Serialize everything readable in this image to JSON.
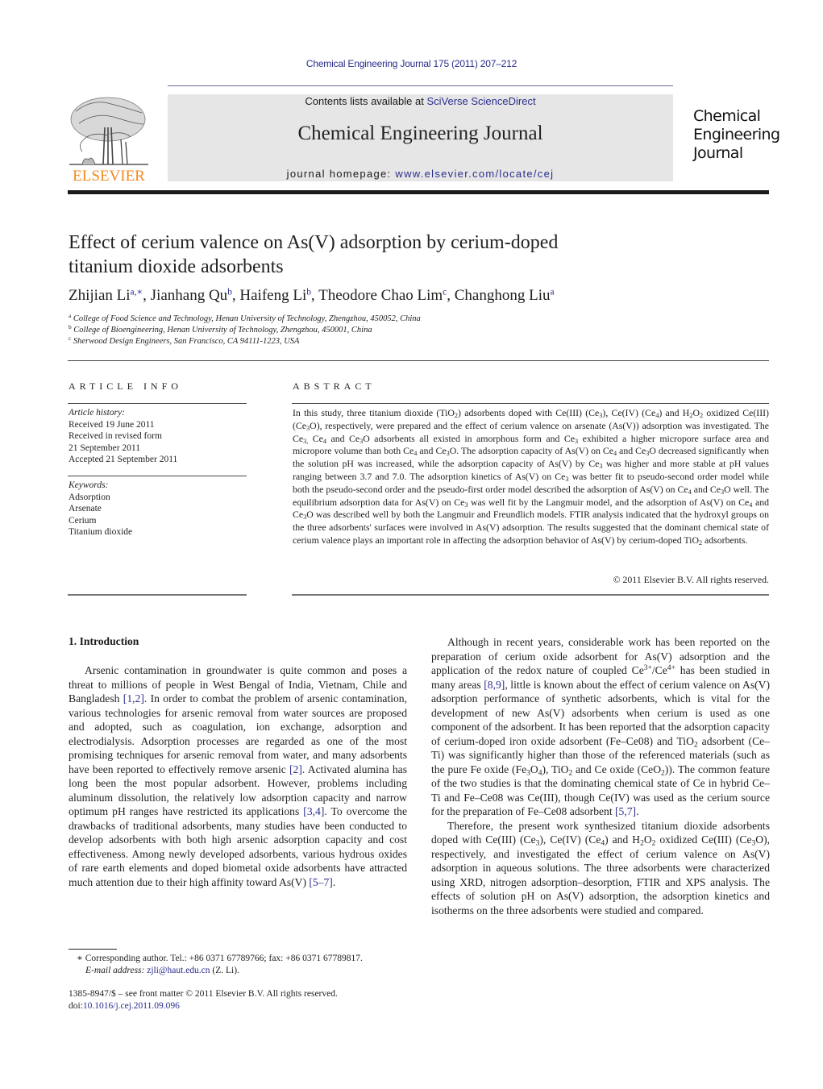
{
  "header": {
    "running_head": "Chemical Engineering Journal 175 (2011) 207–212",
    "publisher_logo_text": "ELSEVIER",
    "contents_prefix": "Contents lists available at ",
    "contents_link": "SciVerse ScienceDirect",
    "journal_name": "Chemical Engineering Journal",
    "homepage_prefix": "journal homepage: ",
    "homepage_link": "www.elsevier.com/locate/cej",
    "cover_title_lines": [
      "Chemical",
      "Engineering",
      "Journal"
    ]
  },
  "article": {
    "title_line1": "Effect of cerium valence on As(V) adsorption by cerium-doped",
    "title_line2": "titanium dioxide adsorbents",
    "authors": [
      {
        "name": "Zhijian Li",
        "affil": "a,∗"
      },
      {
        "name": "Jianhang Qu",
        "affil": "b"
      },
      {
        "name": "Haifeng Li",
        "affil": "b"
      },
      {
        "name": "Theodore Chao Lim",
        "affil": "c"
      },
      {
        "name": "Changhong Liu",
        "affil": "a"
      }
    ],
    "affiliations": [
      {
        "mark": "a",
        "text": "College of Food Science and Technology, Henan University of Technology, Zhengzhou, 450052, China"
      },
      {
        "mark": "b",
        "text": "College of Bioengineering, Henan University of Technology, Zhengzhou, 450001, China"
      },
      {
        "mark": "c",
        "text": "Sherwood Design Engineers, San Francisco, CA 94111-1223, USA"
      }
    ]
  },
  "article_info": {
    "label": "ARTICLE INFO",
    "history_heading": "Article history:",
    "history": [
      "Received 19 June 2011",
      "Received in revised form",
      "21 September 2011",
      "Accepted 21 September 2011"
    ],
    "keywords_heading": "Keywords:",
    "keywords": [
      "Adsorption",
      "Arsenate",
      "Cerium",
      "Titanium dioxide"
    ]
  },
  "abstract": {
    "label": "ABSTRACT",
    "html": "In this study, three titanium dioxide (TiO<sub>2</sub>) adsorbents doped with Ce(III) (Ce<sub>3</sub>), Ce(IV) (Ce<sub>4</sub>) and H<sub>2</sub>O<sub>2</sub> oxidized Ce(III) (Ce<sub>3</sub>O), respectively, were prepared and the effect of cerium valence on arsenate (As(V)) adsorption was investigated. The Ce<sub>3,</sub> Ce<sub>4</sub> and Ce<sub>3</sub>O adsorbents all existed in amorphous form and Ce<sub>3</sub> exhibited a higher micropore surface area and micropore volume than both Ce<sub>4</sub> and Ce<sub>3</sub>O. The adsorption capacity of As(V) on Ce<sub>4</sub> and Ce<sub>3</sub>O decreased significantly when the solution pH was increased, while the adsorption capacity of As(V) by Ce<sub>3</sub> was higher and more stable at pH values ranging between 3.7 and 7.0. The adsorption kinetics of As(V) on Ce<sub>3</sub> was better fit to pseudo-second order model while both the pseudo-second order and the pseudo-first order model described the adsorption of As(V) on Ce<sub>4</sub> and Ce<sub>3</sub>O well. The equilibrium adsorption data for As(V) on Ce<sub>3</sub> was well fit by the Langmuir model, and the adsorption of As(V) on Ce<sub>4</sub> and Ce<sub>3</sub>O was described well by both the Langmuir and Freundlich models. FTIR analysis indicated that the hydroxyl groups on the three adsorbents' surfaces were involved in As(V) adsorption. The results suggested that the dominant chemical state of cerium valence plays an important role in affecting the adsorption behavior of As(V) by cerium-doped TiO<sub>2</sub> adsorbents.",
    "copyright": "© 2011 Elsevier B.V. All rights reserved."
  },
  "body": {
    "section_heading": "1.  Introduction",
    "left_paragraphs": [
      "Arsenic contamination in groundwater is quite common and poses a threat to millions of people in West Bengal of India, Vietnam, Chile and Bangladesh <span class=\"link\">[1,2]</span>. In order to combat the problem of arsenic contamination, various technologies for arsenic removal from water sources are proposed and adopted, such as coagulation, ion exchange, adsorption and electrodialysis. Adsorption processes are regarded as one of the most promising techniques for arsenic removal from water, and many adsorbents have been reported to effectively remove arsenic <span class=\"link\">[2]</span>. Activated alumina has long been the most popular adsorbent. However, problems including aluminum dissolution, the relatively low adsorption capacity and narrow optimum pH ranges have restricted its applications <span class=\"link\">[3,4]</span>. To overcome the drawbacks of traditional adsorbents, many studies have been conducted to develop adsorbents with both high arsenic adsorption capacity and cost effectiveness. Among newly developed adsorbents, various hydrous oxides of rare earth elements and doped biometal oxide adsorbents have attracted much attention due to their high affinity toward As(V) <span class=\"link\">[5–7]</span>."
    ],
    "right_paragraphs": [
      "Although in recent years, considerable work has been reported on the preparation of cerium oxide adsorbent for As(V) adsorption and the application of the redox nature of coupled Ce<sup>3+</sup>/Ce<sup>4+</sup> has been studied in many areas <span class=\"link\">[8,9]</span>, little is known about the effect of cerium valence on As(V) adsorption performance of synthetic adsorbents, which is vital for the development of new As(V) adsorbents when cerium is used as one component of the adsorbent. It has been reported that the adsorption capacity of cerium-doped iron oxide adsorbent (Fe–Ce08) and TiO<sub>2</sub> adsorbent (Ce–Ti) was significantly higher than those of the referenced materials (such as the pure Fe oxide (Fe<sub>3</sub>O<sub>4</sub>), TiO<sub>2</sub> and Ce oxide (CeO<sub>2</sub>)). The common feature of the two studies is that the dominating chemical state of Ce in hybrid Ce–Ti and Fe–Ce08 was Ce(III), though Ce(IV) was used as the cerium source for the preparation of Fe–Ce08 adsorbent <span class=\"link\">[5,7]</span>.",
      "Therefore, the present work synthesized titanium dioxide adsorbents doped with Ce(III) (Ce<sub>3</sub>), Ce(IV) (Ce<sub>4</sub>) and H<sub>2</sub>O<sub>2</sub> oxidized Ce(III) (Ce<sub>3</sub>O), respectively, and investigated the effect of cerium valence on As(V) adsorption in aqueous solutions. The three adsorbents were characterized using XRD, nitrogen adsorption–desorption, FTIR and XPS analysis. The effects of solution pH on As(V) adsorption, the adsorption kinetics and isotherms on the three adsorbents were studied and compared."
    ]
  },
  "footnote": {
    "marker": "∗",
    "corresponding": "Corresponding author. Tel.: +86 0371 67789766; fax: +86 0371 67789817.",
    "email_label": "E-mail address:",
    "email": "zjli@haut.edu.cn",
    "email_suffix": " (Z. Li).",
    "front_matter": "1385-8947/$ – see front matter © 2011 Elsevier B.V. All rights reserved.",
    "doi_prefix": "doi:",
    "doi": "10.1016/j.cej.2011.09.096"
  },
  "colors": {
    "link": "#2b2e8c",
    "elsevier_orange": "#f08a1c",
    "banner_gray": "#e6e6e6"
  }
}
